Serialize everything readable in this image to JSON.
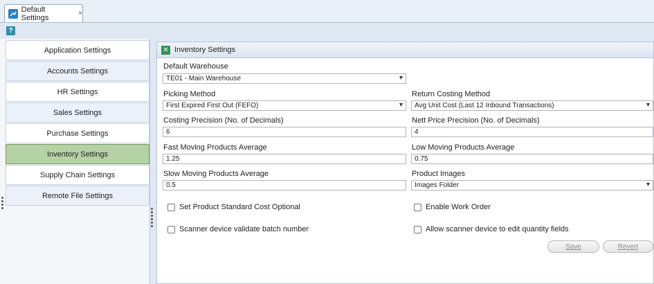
{
  "tab": {
    "label": "Default Settings",
    "close": "×"
  },
  "help": "?",
  "sidebar": {
    "items": [
      {
        "label": "Application Settings"
      },
      {
        "label": "Accounts Settings"
      },
      {
        "label": "HR Settings"
      },
      {
        "label": "Sales Settings"
      },
      {
        "label": "Purchase Settings"
      },
      {
        "label": "Inventory Settings"
      },
      {
        "label": "Supply Chain Settings"
      },
      {
        "label": "Remote File Settings"
      }
    ],
    "active_index": 5
  },
  "panel": {
    "title": "Inventory Settings",
    "default_warehouse": {
      "label": "Default Warehouse",
      "value": "TE01 - Main Warehouse"
    },
    "picking_method": {
      "label": "Picking Method",
      "value": "First Expired First Out (FEFO)"
    },
    "return_costing_method": {
      "label": "Return Costing Method",
      "value": "Avg Unit Cost (Last 12 Inbound Transactions)"
    },
    "costing_precision": {
      "label": "Costing Precision (No. of Decimals)",
      "value": "6"
    },
    "nett_price_precision": {
      "label": "Nett Price Precision (No. of Decimals)",
      "value": "4"
    },
    "fast_moving": {
      "label": "Fast Moving Products Average",
      "value": "1.25"
    },
    "low_moving": {
      "label": "Low Moving Products Average",
      "value": "0.75"
    },
    "slow_moving": {
      "label": "Slow Moving Products Average",
      "value": "0.5"
    },
    "product_images": {
      "label": "Product Images",
      "value": "Images Folder"
    },
    "checkboxes": {
      "std_cost_optional": "Set Product Standard Cost Optional",
      "enable_work_order": "Enable Work Order",
      "scanner_validate_batch": "Scanner device validate batch number",
      "scanner_edit_qty": "Allow scanner device to edit quantity fields"
    },
    "buttons": {
      "save": "Save",
      "revert": "Revert"
    }
  },
  "colors": {
    "active_tab": "#b5d2a6",
    "accent": "#2f7fc4"
  }
}
